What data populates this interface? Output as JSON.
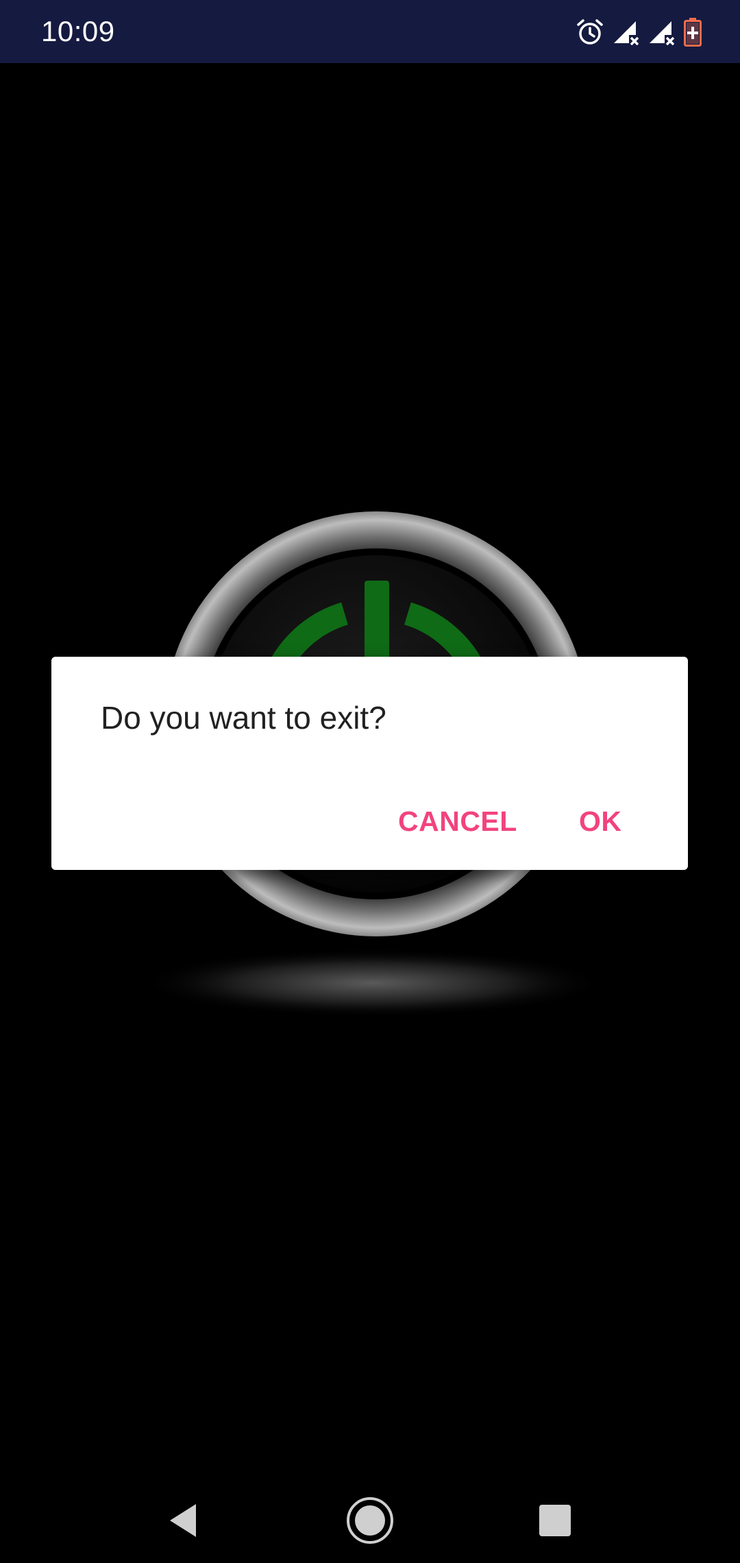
{
  "status_bar": {
    "time": "10:09",
    "icons": [
      "alarm-icon",
      "signal-no-data-icon",
      "signal-no-data-icon",
      "battery-charging-icon"
    ],
    "colors": {
      "background": "#151a40",
      "battery": "#f26d4c"
    }
  },
  "background": {
    "artwork": "power-button-icon",
    "colors": {
      "ring": "#9a9a9a",
      "power_symbol": "#0f6b16"
    }
  },
  "dialog": {
    "message": "Do you want to exit?",
    "cancel_label": "CANCEL",
    "ok_label": "OK",
    "colors": {
      "accent": "#f2437f",
      "text": "#212121"
    }
  },
  "nav_bar": {
    "back": "back-icon",
    "home": "home-icon",
    "recents": "recents-icon"
  }
}
